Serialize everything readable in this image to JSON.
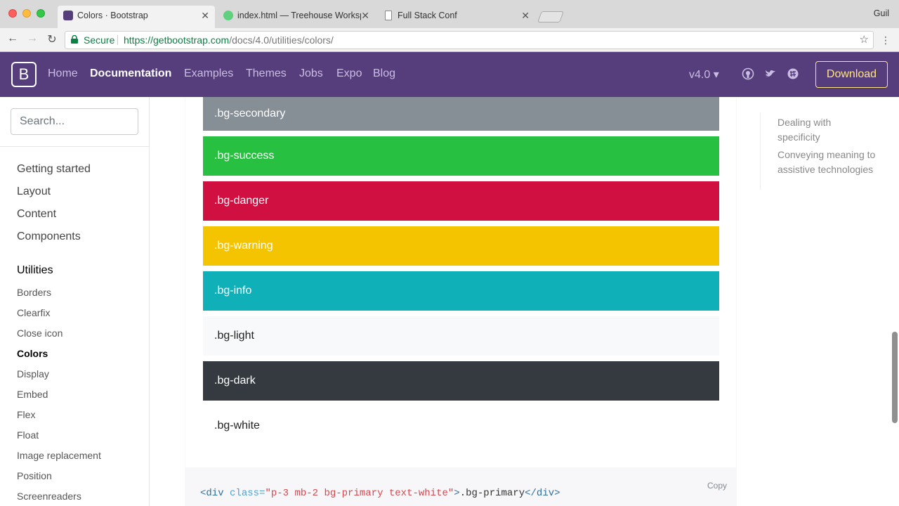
{
  "browser": {
    "tabs": [
      {
        "label": "Colors · Bootstrap",
        "active": true
      },
      {
        "label": "index.html — Treehouse Workspace",
        "active": false
      },
      {
        "label": "Full Stack Conf",
        "active": false
      }
    ],
    "user": "Guil",
    "secure_label": "Secure",
    "url_host": "https://getbootstrap.com",
    "url_path": "/docs/4.0/utilities/colors/"
  },
  "navbar": {
    "brand": "B",
    "links": [
      "Home",
      "Documentation",
      "Examples",
      "Themes",
      "Jobs",
      "Expo",
      "Blog"
    ],
    "version": "v4.0 ▾",
    "download": "Download"
  },
  "sidebar": {
    "search_placeholder": "Search...",
    "groups": [
      "Getting started",
      "Layout",
      "Content",
      "Components",
      "Utilities"
    ],
    "items": [
      "Borders",
      "Clearfix",
      "Close icon",
      "Colors",
      "Display",
      "Embed",
      "Flex",
      "Float",
      "Image replacement",
      "Position",
      "Screenreaders"
    ]
  },
  "swatches": [
    {
      "label": ".bg-secondary",
      "bg": "#868e96",
      "fg": "#ffffff"
    },
    {
      "label": ".bg-success",
      "bg": "#28c040",
      "fg": "#ffffff"
    },
    {
      "label": ".bg-danger",
      "bg": "#d01040",
      "fg": "#ffffff"
    },
    {
      "label": ".bg-warning",
      "bg": "#f5c400",
      "fg": "#ffffff"
    },
    {
      "label": ".bg-info",
      "bg": "#10b0b8",
      "fg": "#ffffff"
    },
    {
      "label": ".bg-light",
      "bg": "#f8f9fa",
      "fg": "#222222"
    },
    {
      "label": ".bg-dark",
      "bg": "#343a40",
      "fg": "#ffffff"
    },
    {
      "label": ".bg-white",
      "bg": "#ffffff",
      "fg": "#222222"
    }
  ],
  "code": {
    "copy_label": "Copy",
    "tag_open": "<div ",
    "attr_name": "class=",
    "attr_value": "\"p-3 mb-2 bg-primary text-white\"",
    "tag_close": ">",
    "text": ".bg-primary",
    "end_tag": "</div>"
  },
  "toc": {
    "items": [
      "Dealing with specificity",
      "Conveying meaning to assistive technologies"
    ]
  },
  "colors": {
    "bootstrap_purple": "#563d7c",
    "download_yellow": "#ffe484",
    "secure_green": "#0b8043"
  }
}
